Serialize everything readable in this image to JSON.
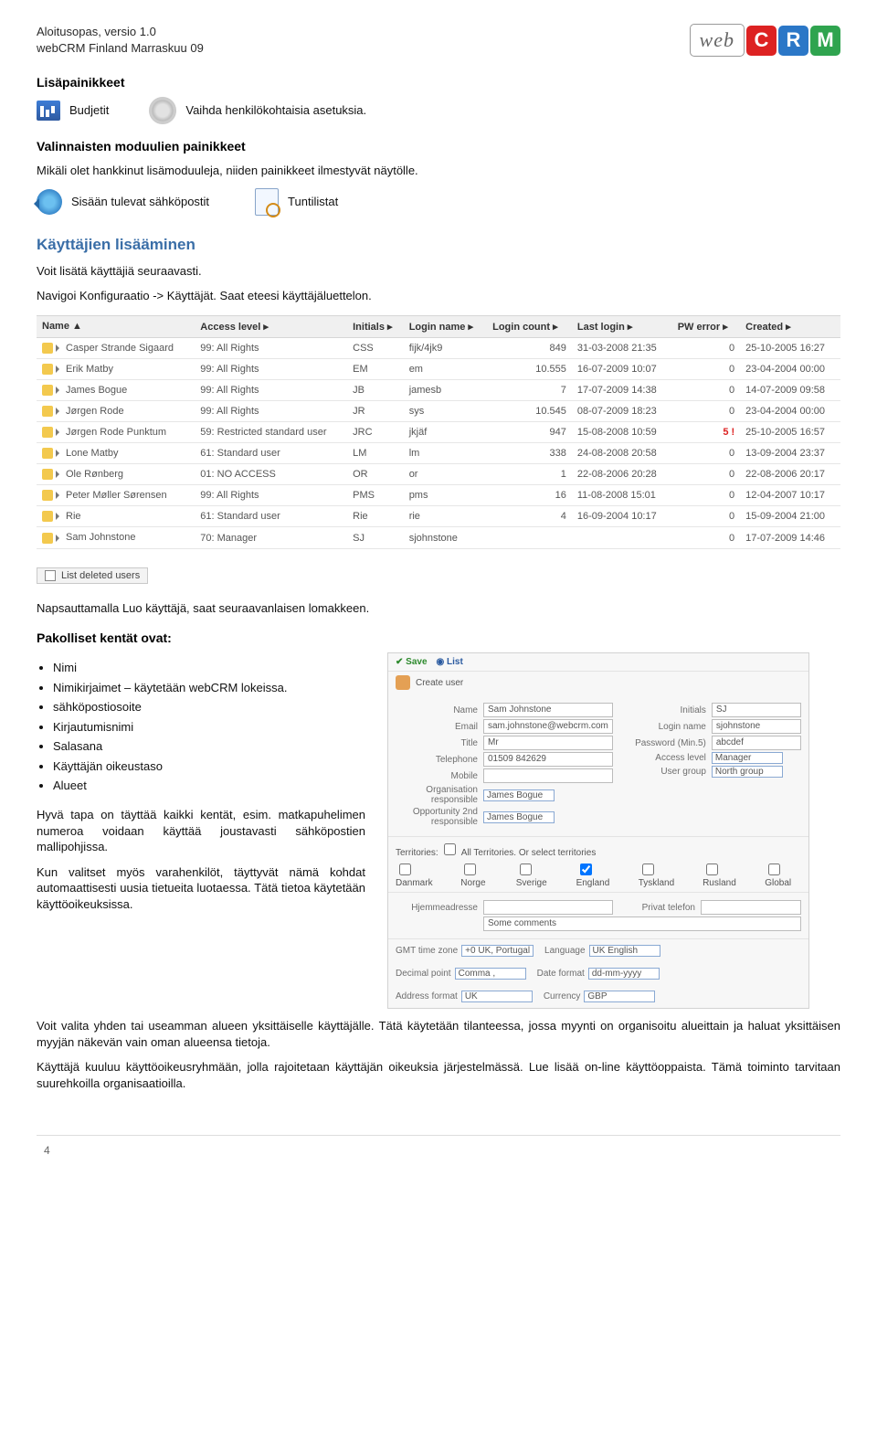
{
  "header": {
    "line1": "Aloitusopas, versio 1.0",
    "line2": "webCRM Finland Marraskuu 09"
  },
  "logo": {
    "web": "web",
    "c": "C",
    "r": "R",
    "m": "M"
  },
  "s1": {
    "title": "Lisäpainikkeet",
    "budget_label": "Budjetit",
    "settings_label": "Vaihda henkilökohtaisia asetuksia.",
    "opt_title": "Valinnaisten moduulien painikkeet",
    "opt_desc": "Mikäli olet hankkinut lisämoduuleja, niiden painikkeet ilmestyvät näytölle.",
    "inbound_label": "Sisään tulevat sähköpostit",
    "hourlist_label": "Tuntilistat"
  },
  "s2": {
    "title": "Käyttäjien lisääminen",
    "p1": "Voit lisätä käyttäjiä seuraavasti.",
    "p2": "Navigoi Konfiguraatio -> Käyttäjät. Saat eteesi käyttäjäluettelon."
  },
  "table_headers": [
    "Name ▲",
    "Access level ▸",
    "Initials ▸",
    "Login name ▸",
    "Login count ▸",
    "Last login ▸",
    "PW error ▸",
    "Created ▸"
  ],
  "users": [
    {
      "name": "Casper Strande Sigaard",
      "access": "99: All Rights",
      "ini": "CSS",
      "login": "fijk/4jk9",
      "count": "849",
      "last": "31-03-2008 21:35",
      "pw": "0",
      "created": "25-10-2005 16:27"
    },
    {
      "name": "Erik Matby",
      "access": "99: All Rights",
      "ini": "EM",
      "login": "em",
      "count": "10.555",
      "last": "16-07-2009 10:07",
      "pw": "0",
      "created": "23-04-2004 00:00"
    },
    {
      "name": "James Bogue",
      "access": "99: All Rights",
      "ini": "JB",
      "login": "jamesb",
      "count": "7",
      "last": "17-07-2009 14:38",
      "pw": "0",
      "created": "14-07-2009 09:58"
    },
    {
      "name": "Jørgen Rode",
      "access": "99: All Rights",
      "ini": "JR",
      "login": "sys",
      "count": "10.545",
      "last": "08-07-2009 18:23",
      "pw": "0",
      "created": "23-04-2004 00:00"
    },
    {
      "name": "Jørgen Rode Punktum",
      "access": "59: Restricted standard user",
      "ini": "JRC",
      "login": "jkjäf",
      "count": "947",
      "last": "15-08-2008 10:59",
      "pw": "5 !",
      "pw_red": true,
      "created": "25-10-2005 16:57"
    },
    {
      "name": "Lone Matby",
      "access": "61: Standard user",
      "ini": "LM",
      "login": "lm",
      "count": "338",
      "last": "24-08-2008 20:58",
      "pw": "0",
      "created": "13-09-2004 23:37"
    },
    {
      "name": "Ole Rønberg",
      "access": "01: NO ACCESS",
      "ini": "OR",
      "login": "or",
      "count": "1",
      "last": "22-08-2006 20:28",
      "pw": "0",
      "created": "22-08-2006 20:17"
    },
    {
      "name": "Peter Møller Sørensen",
      "access": "99: All Rights",
      "ini": "PMS",
      "login": "pms",
      "count": "16",
      "last": "11-08-2008 15:01",
      "pw": "0",
      "created": "12-04-2007 10:17"
    },
    {
      "name": "Rie",
      "access": "61: Standard user",
      "ini": "Rie",
      "login": "rie",
      "count": "4",
      "last": "16-09-2004 10:17",
      "pw": "0",
      "created": "15-09-2004 21:00"
    },
    {
      "name": "Sam Johnstone",
      "access": "70: Manager",
      "ini": "SJ",
      "login": "sjohnstone",
      "count": "",
      "last": "",
      "pw": "0",
      "created": "17-07-2009 14:46"
    }
  ],
  "deleted_btn": "List deleted users",
  "s3": {
    "p_click": "Napsauttamalla Luo käyttäjä, saat seuraavanlaisen lomakkeen.",
    "mandatory_title": "Pakolliset kentät ovat:",
    "bullets": [
      "Nimi",
      "Nimikirjaimet – käytetään webCRM lokeissa.",
      "sähköpostiosoite",
      "Kirjautumisnimi",
      "Salasana",
      "Käyttäjän oikeustaso",
      "Alueet"
    ],
    "para_good": "Hyvä tapa on täyttää kaikki kentät, esim. matkapuhelimen numeroa voidaan käyttää joustavasti sähköpostien mallipohjissa.",
    "para_backup": "Kun valitset myös varahenkilöt, täyttyvät nämä kohdat automaattisesti uusia tietueita luotaessa. Tätä tietoa käytetään käyttöoikeuksissa.",
    "para_area": "Voit valita yhden tai useamman alueen yksittäiselle käyttäjälle. Tätä käytetään tilanteessa, jossa myynti on organisoitu alueittain ja haluat yksittäisen myyjän näkevän vain oman alueensa tietoja.",
    "para_group": "Käyttäjä kuuluu käyttöoikeusryhmään, jolla rajoitetaan käyttäjän oikeuksia järjestelmässä. Lue lisää on-line käyttöoppaista. Tämä toiminto tarvitaan suurehkoilla organisaatioilla."
  },
  "form": {
    "save": "✔ Save",
    "list": "◉ List",
    "create_user": "Create user",
    "name_l": "Name",
    "name_v": "Sam Johnstone",
    "initials_l": "Initials",
    "initials_v": "SJ",
    "email_l": "Email",
    "email_v": "sam.johnstone@webcrm.com",
    "loginname_l": "Login name",
    "loginname_v": "sjohnstone",
    "title_l": "Title",
    "title_v": "Mr",
    "password_l": "Password (Min.5)",
    "password_v": "abcdef",
    "telephone_l": "Telephone",
    "telephone_v": "01509 842629",
    "access_l": "Access level",
    "access_v": "Manager",
    "mobile_l": "Mobile",
    "mobile_v": "",
    "usergroup_l": "User group",
    "usergroup_v": "North group",
    "orgresp_l": "Organisation responsible",
    "orgresp_v": "James Bogue",
    "oppresp_l": "Opportunity 2nd responsible",
    "oppresp_v": "James Bogue",
    "terr_l": "Territories:",
    "terr_all": "All Territories. Or select territories",
    "terr_opts": [
      "Danmark",
      "Norge",
      "Sverige",
      "England",
      "Tyskland",
      "Rusland",
      "Global"
    ],
    "terr_checked": [
      "England"
    ],
    "home_l": "Hjemmeadresse",
    "priv_l": "Privat telefon",
    "comments_l": "Some comments",
    "gmttz_l": "GMT time zone",
    "gmttz_v": "+0 UK, Portugal",
    "lang_l": "Language",
    "lang_v": "UK English",
    "dec_l": "Decimal point",
    "dec_v": "Comma ,",
    "datefmt_l": "Date format",
    "datefmt_v": "dd-mm-yyyy",
    "addr_l": "Address format",
    "addr_v": "UK",
    "cur_l": "Currency",
    "cur_v": "GBP"
  },
  "footer": {
    "page": "4"
  }
}
